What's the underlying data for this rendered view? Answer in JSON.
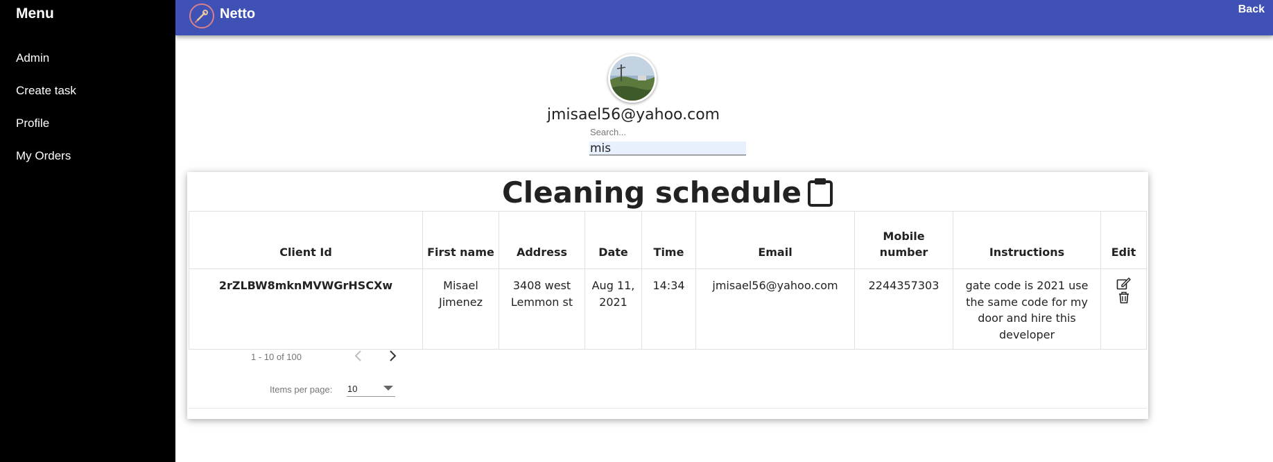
{
  "sidebar": {
    "title": "Menu",
    "items": [
      {
        "label": "Admin"
      },
      {
        "label": "Create task"
      },
      {
        "label": "Profile"
      },
      {
        "label": "My Orders"
      }
    ]
  },
  "appbar": {
    "brand": "Netto",
    "back_label": "Back",
    "color": "#3f51b5"
  },
  "profile": {
    "email": "jmisael56@yahoo.com"
  },
  "search": {
    "label": "Search...",
    "value": "mis"
  },
  "schedule": {
    "title": "Cleaning schedule",
    "title_icon": "clipboard-icon",
    "columns": [
      "Client Id",
      "First name",
      "Address",
      "Date",
      "Time",
      "Email",
      "Mobile number",
      "Instructions",
      "Edit"
    ],
    "rows": [
      {
        "client_id": "2rZLBW8mknMVWGrHSCXw",
        "first_name": "Misael Jimenez",
        "address": "3408 west Lemmon st",
        "date": "Aug 11, 2021",
        "time": "14:34",
        "email": "jmisael56@yahoo.com",
        "mobile": "2244357303",
        "instructions": "gate code is 2021 use the same code for my door and hire this developer",
        "edit_icons": [
          "edit-icon",
          "trash-icon"
        ]
      }
    ]
  },
  "paginator": {
    "range_label": "1 - 10 of 100",
    "items_per_page_label": "Items per page:",
    "items_per_page_value": "10"
  }
}
